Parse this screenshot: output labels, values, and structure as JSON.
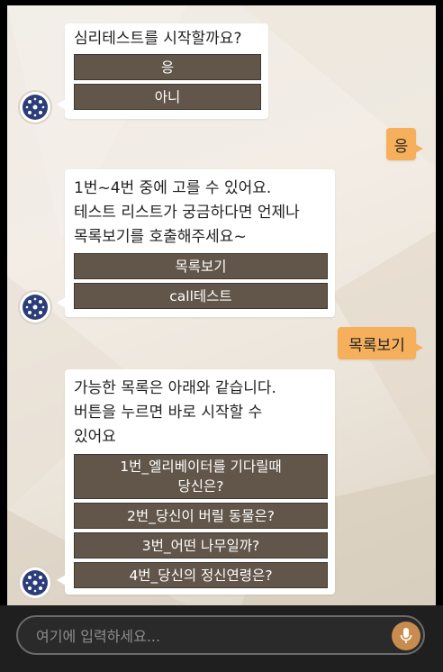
{
  "theme": {
    "accent": "#f6b05c",
    "option_bg": "#62564a",
    "mic_color": "#c98c4f"
  },
  "messages": [
    {
      "from": "bot",
      "text": "심리테스트를 시작할까요?",
      "options": [
        "응",
        "아니"
      ]
    },
    {
      "from": "user",
      "text": "응"
    },
    {
      "from": "bot",
      "text": "1번~4번 중에 고를 수 있어요.\n테스트 리스트가 궁금하다면 언제나\n목록보기를 호출해주세요~",
      "options": [
        "목록보기",
        "call테스트"
      ]
    },
    {
      "from": "user",
      "text": "목록보기"
    },
    {
      "from": "bot",
      "text": "가능한 목록은 아래와 같습니다.\n버튼을 누르면 바로 시작할 수\n있어요",
      "options": [
        "1번_엘리베이터를 기다릴때\n당신은?",
        "2번_당신이 버릴 동물은?",
        "3번_어떤 나무일까?",
        "4번_당신의 정신연령은?"
      ]
    }
  ],
  "input": {
    "placeholder": "여기에 입력하세요..."
  },
  "icons": {
    "avatar": "bot-avatar-icon",
    "mic": "microphone-icon"
  }
}
